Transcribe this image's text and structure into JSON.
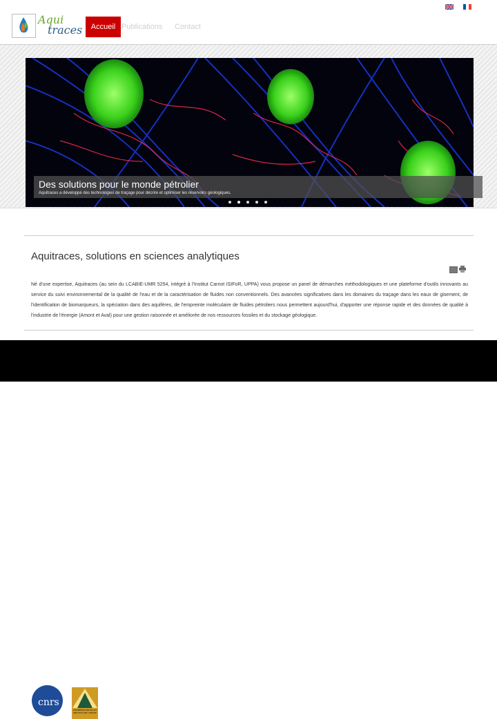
{
  "header": {
    "logo_top": "Aqui",
    "logo_bottom": "traces",
    "nav": [
      "Accueil",
      "Publications",
      "Contact"
    ],
    "flags": [
      "uk-flag-icon",
      "fr-flag-icon"
    ]
  },
  "slider": {
    "title": "Des solutions pour le monde pétrolier",
    "subtitle": "Aquitraces a développé des technologies de traçage pour décrire et optimiser les réservoirs géologiques.",
    "active_slide": 1,
    "slide_count": 5
  },
  "article": {
    "title": "Aquitraces, solutions en sciences analytiques",
    "body": "Né d'une expertise, Aquitraces (au sein du LCABIE-UMR 5254, intégré à l'Institut Carnot ISIFoR, UPPA) vous propose un panel de démarches méthodologiques et une plateforme d'outils innovants au service du suivi environnemental de la qualité de l'eau et de la caractérisation de fluides non conventionnels. Des avancées significatives dans les domaines du traçage dans les eaux de gisement, de l'identification de biomarqueurs, la spéciation dans des aquifères, de l'empreinte moléculaire de fluides pétroliers nous permettent aujourd'hui, d'apporter une réponse rapide et des données de qualité à l'industrie de l'énergie (Amont et Aval) pour une gestion raisonnée et améliorée de nos ressources fossiles et du stockage géologique."
  },
  "footer": {
    "logo_cnrs": "cnrs",
    "logo_uppa": "UNIVERSITE DE PAU ET DES PAYS DE L'ADOUR"
  },
  "colors": {
    "accent": "#cc0000",
    "logo_green": "#6aa62a",
    "logo_blue": "#2b5c86"
  }
}
